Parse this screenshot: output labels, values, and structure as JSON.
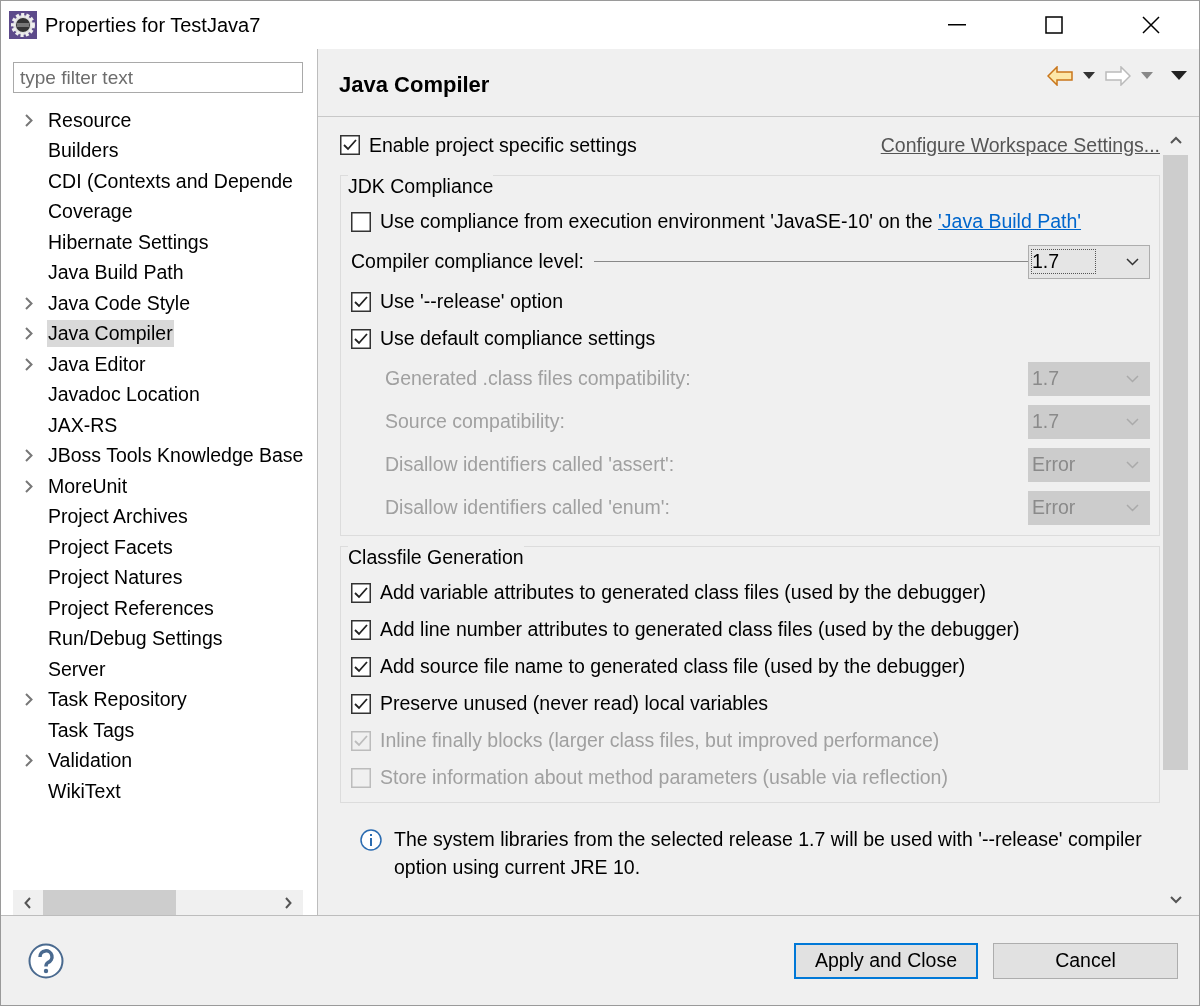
{
  "window": {
    "title": "Properties for TestJava7"
  },
  "filter": {
    "placeholder": "type filter text"
  },
  "tree": [
    {
      "label": "Resource",
      "expandable": true,
      "selected": false
    },
    {
      "label": "Builders",
      "expandable": false,
      "selected": false
    },
    {
      "label": "CDI (Contexts and Depende",
      "expandable": false,
      "selected": false
    },
    {
      "label": "Coverage",
      "expandable": false,
      "selected": false
    },
    {
      "label": "Hibernate Settings",
      "expandable": false,
      "selected": false
    },
    {
      "label": "Java Build Path",
      "expandable": false,
      "selected": false
    },
    {
      "label": "Java Code Style",
      "expandable": true,
      "selected": false
    },
    {
      "label": "Java Compiler",
      "expandable": true,
      "selected": true
    },
    {
      "label": "Java Editor",
      "expandable": true,
      "selected": false
    },
    {
      "label": "Javadoc Location",
      "expandable": false,
      "selected": false
    },
    {
      "label": "JAX-RS",
      "expandable": false,
      "selected": false
    },
    {
      "label": "JBoss Tools Knowledge Base",
      "expandable": true,
      "selected": false
    },
    {
      "label": "MoreUnit",
      "expandable": true,
      "selected": false
    },
    {
      "label": "Project Archives",
      "expandable": false,
      "selected": false
    },
    {
      "label": "Project Facets",
      "expandable": false,
      "selected": false
    },
    {
      "label": "Project Natures",
      "expandable": false,
      "selected": false
    },
    {
      "label": "Project References",
      "expandable": false,
      "selected": false
    },
    {
      "label": "Run/Debug Settings",
      "expandable": false,
      "selected": false
    },
    {
      "label": "Server",
      "expandable": false,
      "selected": false
    },
    {
      "label": "Task Repository",
      "expandable": true,
      "selected": false
    },
    {
      "label": "Task Tags",
      "expandable": false,
      "selected": false
    },
    {
      "label": "Validation",
      "expandable": true,
      "selected": false
    },
    {
      "label": "WikiText",
      "expandable": false,
      "selected": false
    }
  ],
  "page": {
    "title": "Java Compiler",
    "enable_project": {
      "label": "Enable project specific settings",
      "checked": true
    },
    "configure_link": "Configure Workspace Settings...",
    "groups": [
      {
        "title": "JDK Compliance",
        "items": [
          {
            "kind": "checkbox",
            "label": "Use compliance from execution environment 'JavaSE-10' on the ",
            "link": "'Java Build Path'",
            "checked": false,
            "disabled": false
          },
          {
            "kind": "combo",
            "label": "Compiler compliance level:",
            "value": "1.7",
            "disabled": false,
            "leader": true
          },
          {
            "kind": "checkbox",
            "label": "Use '--release' option",
            "checked": true,
            "disabled": false
          },
          {
            "kind": "checkbox",
            "label": "Use default compliance settings",
            "checked": true,
            "disabled": false,
            "children": [
              {
                "kind": "combo",
                "label": "Generated .class files compatibility:",
                "value": "1.7",
                "disabled": true,
                "leader": false
              },
              {
                "kind": "combo",
                "label": "Source compatibility:",
                "value": "1.7",
                "disabled": true,
                "leader": false
              },
              {
                "kind": "combo",
                "label": "Disallow identifiers called 'assert':",
                "value": "Error",
                "disabled": true,
                "leader": false
              },
              {
                "kind": "combo",
                "label": "Disallow identifiers called 'enum':",
                "value": "Error",
                "disabled": true,
                "leader": false
              }
            ]
          }
        ]
      },
      {
        "title": "Classfile Generation",
        "items": [
          {
            "kind": "checkbox",
            "label": "Add variable attributes to generated class files (used by the debugger)",
            "checked": true,
            "disabled": false
          },
          {
            "kind": "checkbox",
            "label": "Add line number attributes to generated class files (used by the debugger)",
            "checked": true,
            "disabled": false
          },
          {
            "kind": "checkbox",
            "label": "Add source file name to generated class file (used by the debugger)",
            "checked": true,
            "disabled": false
          },
          {
            "kind": "checkbox",
            "label": "Preserve unused (never read) local variables",
            "checked": true,
            "disabled": false
          },
          {
            "kind": "checkbox",
            "label": "Inline finally blocks (larger class files, but improved performance)",
            "checked": true,
            "disabled": true
          },
          {
            "kind": "checkbox",
            "label": "Store information about method parameters (usable via reflection)",
            "checked": false,
            "disabled": true
          }
        ]
      }
    ],
    "info": "The system libraries from the selected release 1.7 will be used with '--release' compiler option using current JRE 10."
  },
  "buttons": [
    {
      "label": "Apply and Close",
      "default": true
    },
    {
      "label": "Cancel",
      "default": false
    }
  ]
}
